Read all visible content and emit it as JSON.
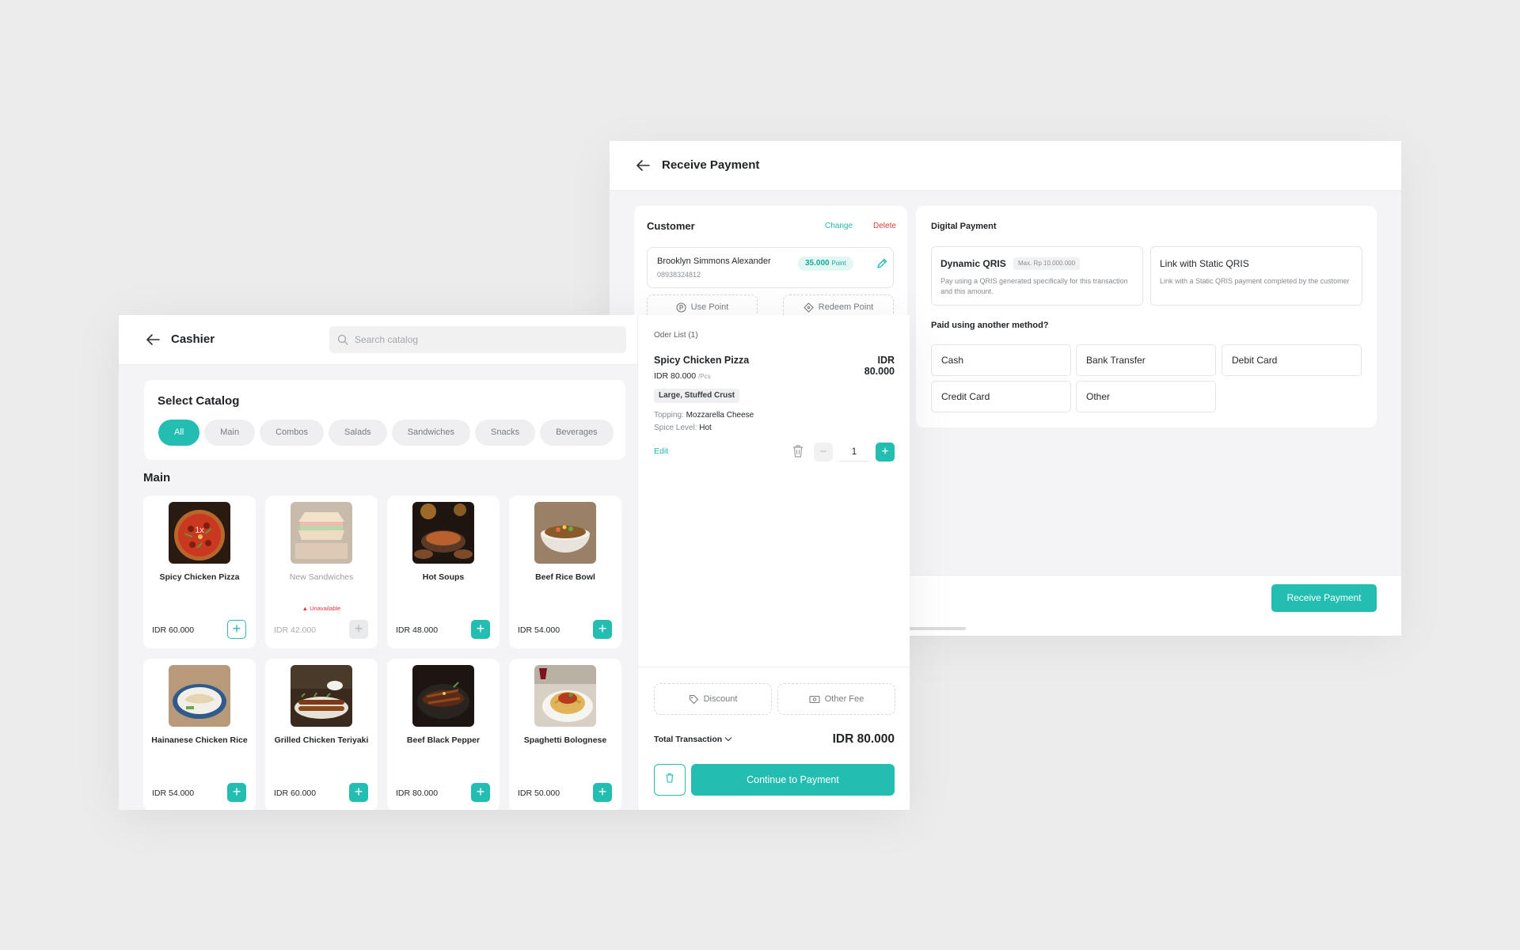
{
  "receive_payment": {
    "title": "Receive Payment",
    "customer": {
      "label": "Customer",
      "change_label": "Change",
      "delete_label": "Delete",
      "name": "Brooklyn Simmons Alexander",
      "phone": "08938324812",
      "points_value": "35.000",
      "points_unit": "Point",
      "use_point_label": "Use Point",
      "redeem_point_label": "Redeem Point"
    },
    "digital_payment": {
      "label": "Digital Payment",
      "options": [
        {
          "title": "Dynamic QRIS",
          "badge": "Max. Rp 10.000.000",
          "desc": "Pay using a QRIS generated specifically for this transaction and this amount."
        },
        {
          "title": "Link with Static QRIS",
          "desc": "Link with a Static QRIS payment completed by the customer"
        }
      ]
    },
    "other_method_label": "Paid using another method?",
    "methods": [
      "Cash",
      "Bank Transfer",
      "Debit Card",
      "Credit Card",
      "Other"
    ],
    "button_label": "Receive Payment"
  },
  "cashier": {
    "title": "Cashier",
    "search_placeholder": "Search catalog",
    "select_catalog_label": "Select Catalog",
    "categories": [
      "All",
      "Main",
      "Combos",
      "Salads",
      "Sandwiches",
      "Snacks",
      "Beverages"
    ],
    "active_category": "All",
    "section_label": "Main",
    "products": [
      {
        "name": "Spicy Chicken Pizza",
        "price": "IDR 60.000",
        "in_cart": "1x"
      },
      {
        "name": "New Sandwiches",
        "price": "IDR 42.000",
        "status": "Unavailable"
      },
      {
        "name": "Hot Soups",
        "price": "IDR 48.000"
      },
      {
        "name": "Beef Rice Bowl",
        "price": "IDR 54.000"
      },
      {
        "name": "Hainanese Chicken Rice",
        "price": "IDR 54.000"
      },
      {
        "name": "Grilled Chicken Teriyaki",
        "price": "IDR 60.000"
      },
      {
        "name": "Beef Black Pepper",
        "price": "IDR 80.000"
      },
      {
        "name": "Spaghetti Bolognese",
        "price": "IDR 50.000"
      }
    ]
  },
  "order": {
    "list_label": "Oder List (1)",
    "item": {
      "name": "Spicy Chicken Pizza",
      "total": "IDR 80.000",
      "unit_price": "IDR 80.000",
      "unit": "/Pcs",
      "variant": "Large, Stuffed Crust",
      "topping_label": "Topping:",
      "topping": "Mozzarella Cheese",
      "spice_label": "Spice Level:",
      "spice": "Hot",
      "edit_label": "Edit",
      "qty": "1"
    },
    "discount_label": "Discount",
    "other_fee_label": "Other Fee",
    "total_label": "Total Transaction",
    "total_value": "IDR 80.000",
    "continue_label": "Continue to Payment"
  },
  "colors": {
    "accent": "#23bdb1",
    "danger": "#e3383b"
  }
}
